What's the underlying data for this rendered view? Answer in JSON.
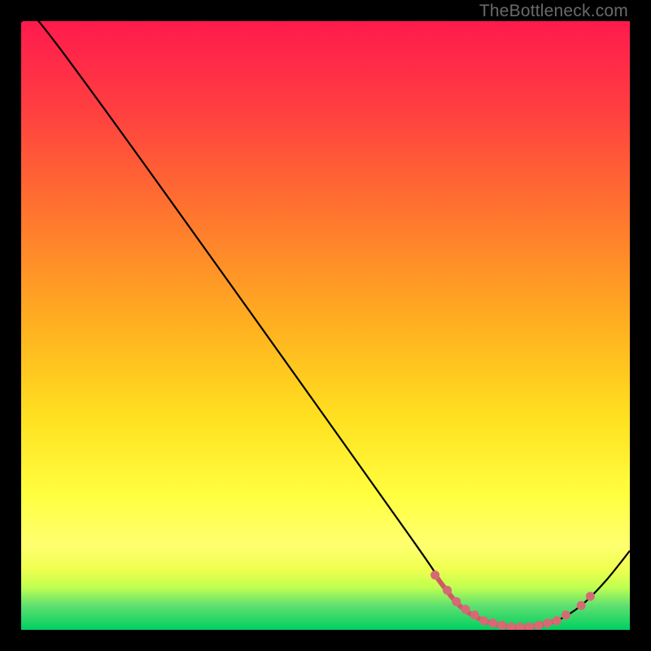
{
  "attribution": "TheBottleneck.com",
  "chart_data": {
    "type": "line",
    "title": "",
    "xlabel": "",
    "ylabel": "",
    "xlim": [
      0,
      100
    ],
    "ylim": [
      0,
      100
    ],
    "curve": [
      {
        "x": 0,
        "y": 100
      },
      {
        "x": 6,
        "y": 96
      },
      {
        "x": 62,
        "y": 18
      },
      {
        "x": 68,
        "y": 9
      },
      {
        "x": 72,
        "y": 4
      },
      {
        "x": 76,
        "y": 1.5
      },
      {
        "x": 80,
        "y": 0.5
      },
      {
        "x": 84,
        "y": 0.5
      },
      {
        "x": 88,
        "y": 1.5
      },
      {
        "x": 92,
        "y": 4
      },
      {
        "x": 96,
        "y": 8
      },
      {
        "x": 100,
        "y": 13
      }
    ],
    "flat_region_x": [
      68,
      88
    ],
    "flat_markers_x": [
      68,
      70,
      71.5,
      73,
      74.5,
      76,
      77.5,
      79,
      80.5,
      82,
      83.5,
      85,
      86.5,
      88,
      89.5,
      92,
      93.5
    ],
    "colors": {
      "line": "#000000",
      "line_flat": "#cc5a64",
      "markers": "#d66a74"
    }
  }
}
